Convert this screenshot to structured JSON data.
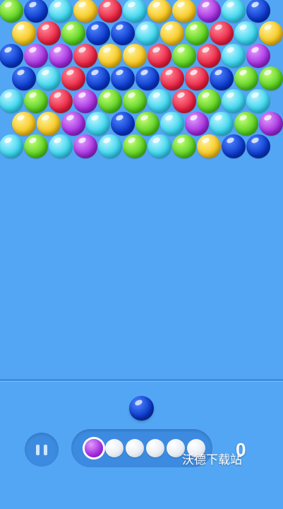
{
  "game": {
    "current_bubble": "blue",
    "rows": [
      [
        "green",
        "blue",
        "cyan",
        "yellow",
        "red",
        "cyan",
        "yellow",
        "yellow",
        "purple",
        "cyan",
        "blue"
      ],
      [
        "yellow",
        "red",
        "green",
        "blue",
        "blue",
        "cyan",
        "yellow",
        "green",
        "red",
        "cyan",
        "yellow"
      ],
      [
        "blue",
        "purple",
        "purple",
        "red",
        "yellow",
        "yellow",
        "red",
        "green",
        "red",
        "cyan",
        "purple"
      ],
      [
        "blue",
        "cyan",
        "red",
        "blue",
        "blue",
        "blue",
        "red",
        "red",
        "blue",
        "green",
        "green"
      ],
      [
        "cyan",
        "green",
        "red",
        "purple",
        "green",
        "green",
        "cyan",
        "red",
        "green",
        "cyan",
        "cyan"
      ],
      [
        "yellow",
        "yellow",
        "purple",
        "cyan",
        "blue",
        "green",
        "cyan",
        "purple",
        "cyan",
        "green",
        "purple"
      ],
      [
        "cyan",
        "green",
        "cyan",
        "purple",
        "cyan",
        "green",
        "cyan",
        "green",
        "yellow",
        "blue",
        "blue"
      ]
    ]
  },
  "queue": {
    "balls": [
      "purple",
      "white",
      "white",
      "white",
      "white",
      "white"
    ]
  },
  "score": "0",
  "watermark": "沃德下载站",
  "icons": {
    "pause": "pause-icon"
  }
}
